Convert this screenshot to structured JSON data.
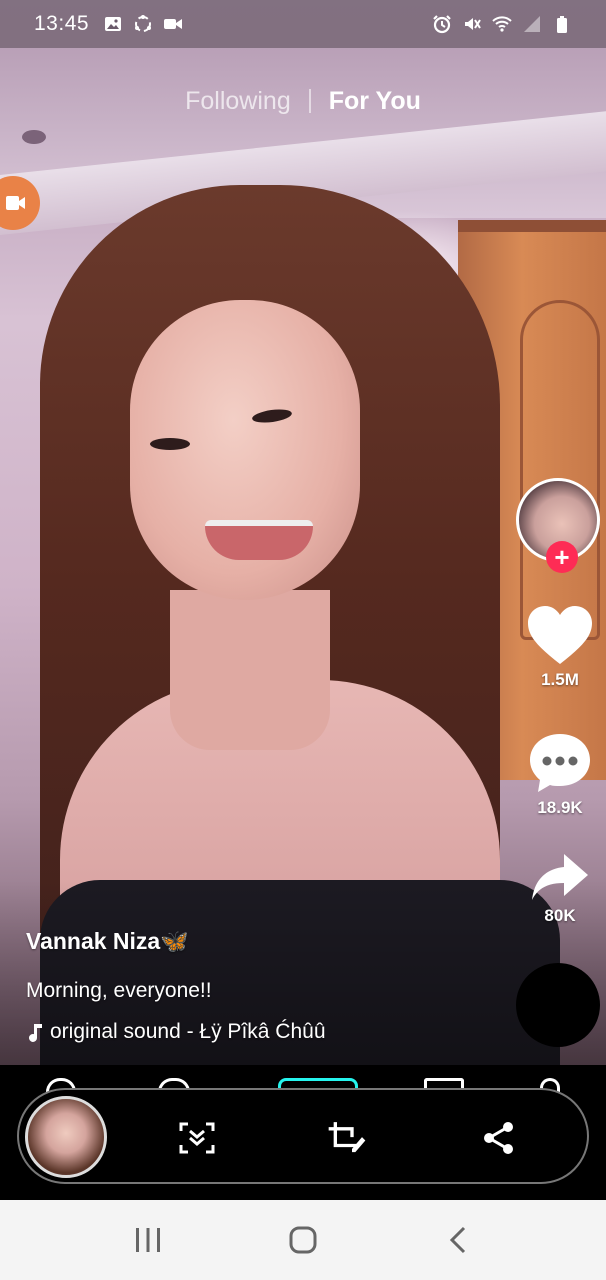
{
  "status_bar": {
    "time": "13:45",
    "left_icons": [
      "gallery-icon",
      "sync-icon",
      "video-record-icon"
    ],
    "right_icons": [
      "alarm-icon",
      "mute-icon",
      "wifi-icon",
      "signal-icon",
      "battery-icon"
    ]
  },
  "top_tabs": {
    "following": "Following",
    "for_you": "For You",
    "active": "For You"
  },
  "video": {
    "author": "Vannak Niza🦋",
    "caption": "Morning, everyone!!",
    "sound": "original sound - Łÿ Pîkâ Ćhûû"
  },
  "actions": {
    "likes": "1.5M",
    "comments": "18.9K",
    "shares": "80K"
  },
  "screenshot_toolbar": {
    "buttons": [
      "scroll-capture-icon",
      "crop-edit-icon",
      "share-icon"
    ]
  },
  "system_nav": {
    "buttons": [
      "recents-icon",
      "home-icon",
      "back-icon"
    ]
  },
  "colors": {
    "accent_red": "#fe2c55",
    "live_orange": "#e98247",
    "toolbar_bg": "#000000",
    "system_nav_bg": "#f4f4f4"
  }
}
